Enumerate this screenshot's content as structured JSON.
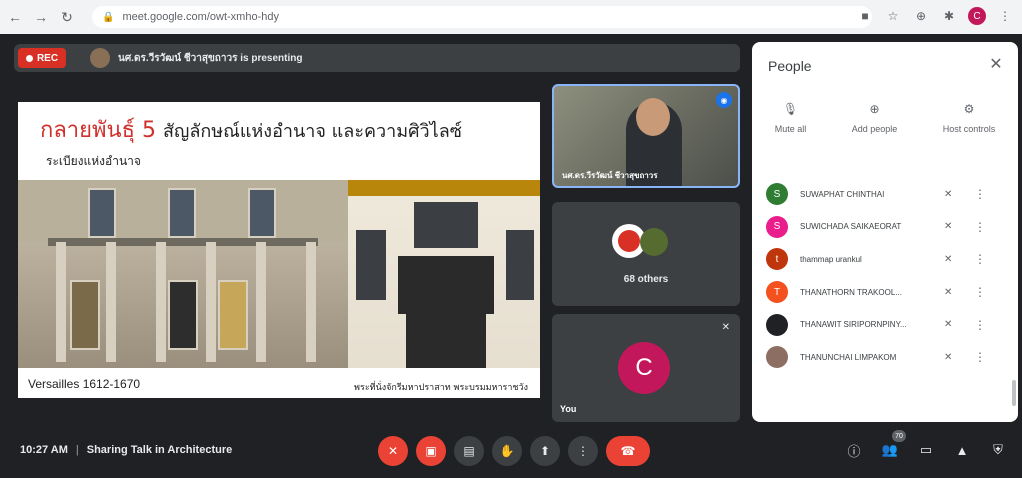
{
  "browser": {
    "url": "meet.google.com/owt-xmho-hdy",
    "profile_initial": "C"
  },
  "meet": {
    "rec_label": "REC",
    "presenting_text": "นศ.ดร.วีรวัฒน์ ชีวาสุขถาวร is presenting",
    "slide": {
      "title_red": "กลายพันธุ์ 5",
      "title_dark": "สัญลักษณ์แห่งอำนาจ และความศิวิไลซ์",
      "subtitle": "ระเบียงแห่งอำนาจ",
      "caption_left": "Versailles 1612-1670",
      "caption_right": "พระที่นั่งจักรีมหาปราสาท พระบรมมหาราชวัง"
    },
    "tiles": {
      "camera_label": "นศ.ดร.วีรวัฒน์ ชีวาสุขถาวร",
      "others_label": "68 others",
      "you_label": "You",
      "you_initial": "C"
    },
    "people_panel": {
      "title": "People",
      "actions": [
        {
          "label": "Mute all",
          "icon": "mic-off-icon"
        },
        {
          "label": "Add people",
          "icon": "add-person-icon"
        },
        {
          "label": "Host controls",
          "icon": "host-controls-icon"
        }
      ],
      "participants": [
        {
          "name": "SUWAPHAT CHINTHAI",
          "initial": "S",
          "color": "#2e7d32"
        },
        {
          "name": "SUWICHADA SAIKAEORAT",
          "initial": "S",
          "color": "#e91e8c"
        },
        {
          "name": "thammap urankul",
          "initial": "t",
          "color": "#bf360c"
        },
        {
          "name": "THANATHORN TRAKOOL...",
          "initial": "T",
          "color": "#f4511e"
        },
        {
          "name": "THANAWIT SIRIPORNPINY...",
          "initial": "",
          "color": "#202124"
        },
        {
          "name": "THANUNCHAI LIMPAKOM",
          "initial": "",
          "color": "#8d6e63"
        }
      ]
    },
    "bottom_bar": {
      "time": "10:27 AM",
      "meeting_title": "Sharing Talk in Architecture",
      "people_count": "70"
    }
  }
}
